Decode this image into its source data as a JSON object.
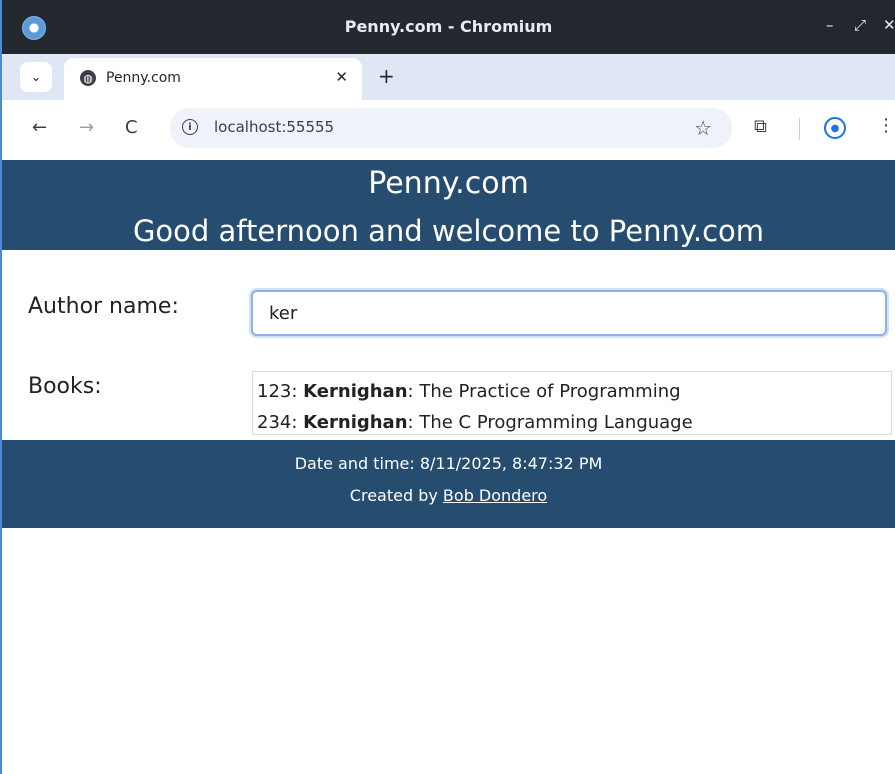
{
  "window": {
    "title": "Penny.com - Chromium",
    "controls": {
      "minimize": "–",
      "restore": "⤢",
      "close": "✕"
    }
  },
  "tabs": [
    {
      "label": "Penny.com",
      "favicon": "globe-icon",
      "close": "✕"
    }
  ],
  "tabstrip": {
    "list_glyph": "⌄",
    "new_tab": "+"
  },
  "toolbar": {
    "back": "←",
    "forward": "→",
    "reload": "C",
    "url": "localhost:55555",
    "star": "☆",
    "menu": "⋮"
  },
  "page": {
    "title": "Penny.com",
    "greeting": "Good afternoon and welcome to Penny.com",
    "author_label": "Author name:",
    "author_value": "ker",
    "books_label": "Books:",
    "books": [
      {
        "isbn": "123",
        "author": "Kernighan",
        "title": "The Practice of Programming"
      },
      {
        "isbn": "234",
        "author": "Kernighan",
        "title": "The C Programming Language"
      }
    ],
    "footer": {
      "date_time": "Date and time: 8/11/2025, 8:47:32 PM",
      "created_by": "Created by",
      "author_link": "Bob Dondero"
    }
  },
  "colors": {
    "header_bg": "#264d70",
    "titlebar_bg": "#23282e",
    "tabstrip_bg": "#dfe7f5",
    "omnibox_bg": "#eef2f9"
  }
}
